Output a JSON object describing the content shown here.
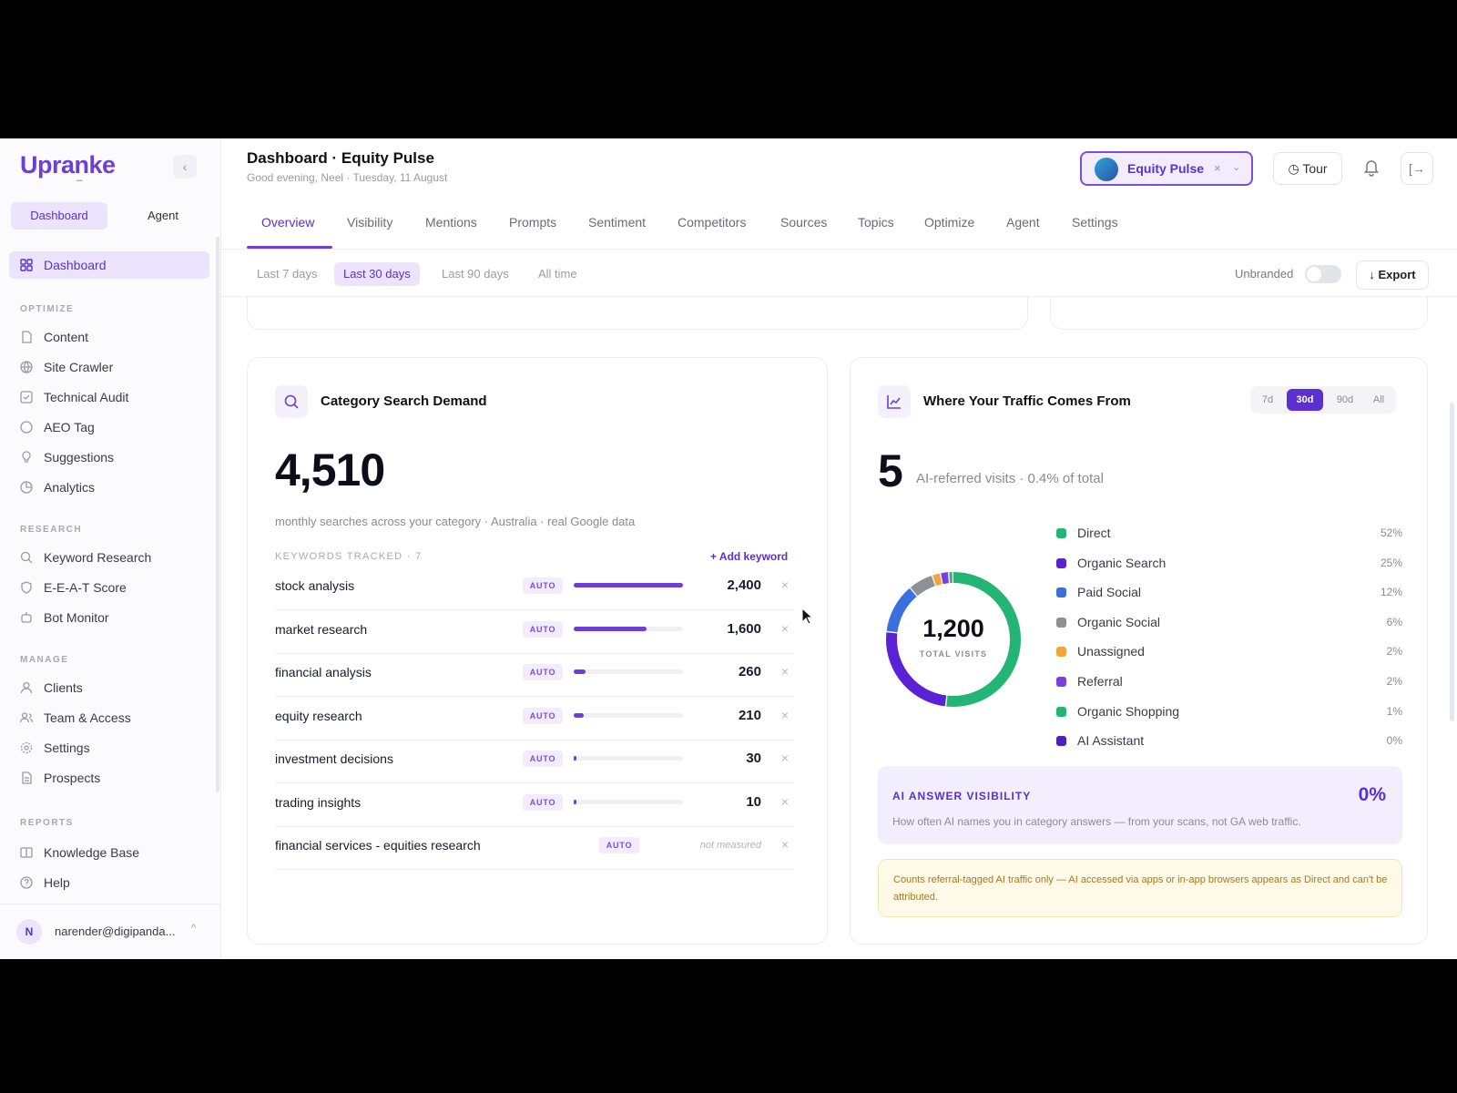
{
  "sidebar": {
    "logo": "Upranke",
    "logo_sub": "•••••",
    "collapse": "‹",
    "mode_tabs": [
      "Dashboard",
      "Agent"
    ],
    "active_item": "Dashboard",
    "sections": {
      "optimize": "OPTIMIZE",
      "research": "RESEARCH",
      "manage": "MANAGE",
      "reports": "REPORTS"
    },
    "optimize_items": [
      "Content",
      "Site Crawler",
      "Technical Audit",
      "AEO Tag",
      "Suggestions",
      "Analytics"
    ],
    "research_items": [
      "Keyword Research",
      "E-E-A-T Score",
      "Bot Monitor"
    ],
    "manage_items": [
      "Clients",
      "Team & Access",
      "Settings",
      "Prospects"
    ],
    "reports_items": [
      "Knowledge Base",
      "Help"
    ],
    "user": {
      "initial": "N",
      "email": "narender@digipanda...",
      "chevron": "^"
    }
  },
  "header": {
    "title": "Dashboard · Equity Pulse",
    "greeting": "Good evening, Neel · Tuesday, 11 August",
    "brand": "Equity Pulse",
    "brand_x": "×",
    "brand_chev": "⌄",
    "tour": "Tour",
    "logout": "[→"
  },
  "tabs": [
    "Overview",
    "Visibility",
    "Mentions",
    "Prompts",
    "Sentiment",
    "Competitors",
    "Sources",
    "Topics",
    "Optimize",
    "Agent",
    "Settings"
  ],
  "filters": {
    "ranges": [
      "Last 7 days",
      "Last 30 days",
      "Last 90 days",
      "All time"
    ],
    "unbranded": "Unbranded",
    "export": "↓ Export"
  },
  "search_demand": {
    "title": "Category Search Demand",
    "total": "4,510",
    "subtitle": "monthly searches across your category · Australia · real Google data",
    "tracked_label": "KEYWORDS TRACKED · 7",
    "add_keyword": "+ Add keyword",
    "badge": "AUTO",
    "keywords": [
      {
        "name": "stock analysis",
        "value": "2,400",
        "share": 1.0
      },
      {
        "name": "market research",
        "value": "1,600",
        "share": 0.67
      },
      {
        "name": "financial analysis",
        "value": "260",
        "share": 0.11
      },
      {
        "name": "equity research",
        "value": "210",
        "share": 0.09
      },
      {
        "name": "investment decisions",
        "value": "30",
        "share": 0.0125
      },
      {
        "name": "trading insights",
        "value": "10",
        "share": 0.004
      },
      {
        "name": "financial services - equities research",
        "value": "not measured",
        "share": 0
      }
    ],
    "remove": "×"
  },
  "traffic": {
    "title": "Where Your Traffic Comes From",
    "periods": [
      "7d",
      "30d",
      "90d",
      "All"
    ],
    "active_period": "30d",
    "ai_visits": "5",
    "ai_visits_text": "AI-referred visits · 0.4% of total",
    "total": "1,200",
    "total_label": "TOTAL VISITS",
    "sources": [
      {
        "name": "Direct",
        "pct": "52%",
        "value": 52,
        "color": "#22b573"
      },
      {
        "name": "Organic Search",
        "pct": "25%",
        "value": 25,
        "color": "#5b21d6"
      },
      {
        "name": "Paid Social",
        "pct": "12%",
        "value": 12,
        "color": "#3b6fe0"
      },
      {
        "name": "Organic Social",
        "pct": "6%",
        "value": 6,
        "color": "#8c9196"
      },
      {
        "name": "Unassigned",
        "pct": "2%",
        "value": 2,
        "color": "#f0a43a"
      },
      {
        "name": "Referral",
        "pct": "2%",
        "value": 2,
        "color": "#7a3fe0"
      },
      {
        "name": "Organic Shopping",
        "pct": "1%",
        "value": 1,
        "color": "#22b573"
      },
      {
        "name": "AI Assistant",
        "pct": "0%",
        "value": 0,
        "color": "#4a1fc4"
      }
    ],
    "ai_visibility_title": "AI ANSWER VISIBILITY",
    "ai_visibility_pct": "0%",
    "ai_visibility_desc": "How often AI names you in category answers — from your scans, not GA web traffic.",
    "note": "Counts referral-tagged AI traffic only — AI accessed via apps or in-app browsers appears as Direct and can't be attributed."
  }
}
